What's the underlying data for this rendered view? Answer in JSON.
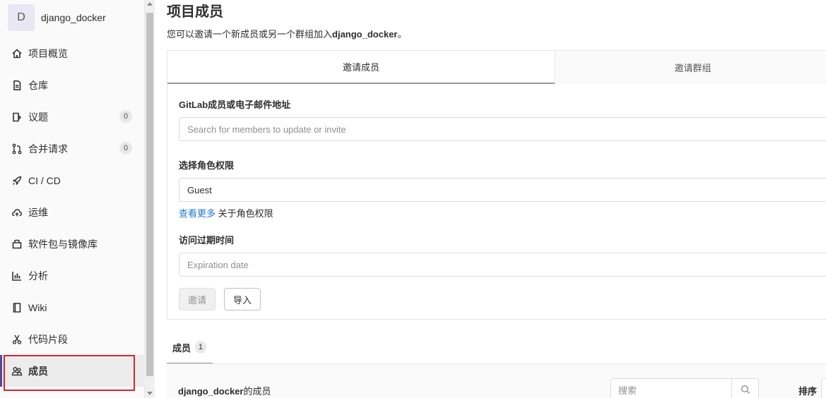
{
  "project": {
    "avatar_letter": "D",
    "name": "django_docker"
  },
  "sidebar": {
    "items": [
      {
        "label": "项目概览",
        "icon": "home-icon"
      },
      {
        "label": "仓库",
        "icon": "doc-icon"
      },
      {
        "label": "议题",
        "icon": "issues-icon",
        "count": "0"
      },
      {
        "label": "合并请求",
        "icon": "merge-request-icon",
        "count": "0"
      },
      {
        "label": "CI / CD",
        "icon": "rocket-icon"
      },
      {
        "label": "运维",
        "icon": "cloud-icon"
      },
      {
        "label": "软件包与镜像库",
        "icon": "package-icon"
      },
      {
        "label": "分析",
        "icon": "chart-icon"
      },
      {
        "label": "Wiki",
        "icon": "book-icon"
      },
      {
        "label": "代码片段",
        "icon": "snippet-icon"
      },
      {
        "label": "成员",
        "icon": "users-icon",
        "active": true
      }
    ],
    "highlight_color": "#d9232e"
  },
  "page": {
    "title": "项目成员",
    "desc_prefix": "您可以邀请一个新成员或另一个群组加入",
    "desc_project": "django_docker",
    "desc_suffix": "。"
  },
  "invite": {
    "tabs": {
      "members": "邀请成员",
      "groups": "邀请群组"
    },
    "member_label": "GitLab成员或电子邮件地址",
    "member_placeholder": "Search for members to update or invite",
    "role_label": "选择角色权限",
    "role_value": "Guest",
    "help_link": "查看更多",
    "help_text": " 关于角色权限",
    "expire_label": "访问过期时间",
    "expire_placeholder": "Expiration date",
    "invite_button": "邀请",
    "import_button": "导入"
  },
  "members": {
    "tab_label": "成员",
    "tab_count": "1",
    "heading_project": "django_docker",
    "heading_suffix": "的成员",
    "search_placeholder": "搜索",
    "sort_label": "排序"
  },
  "colors": {
    "link": "#1f78d1",
    "active_bar": "#4b4ba3"
  }
}
